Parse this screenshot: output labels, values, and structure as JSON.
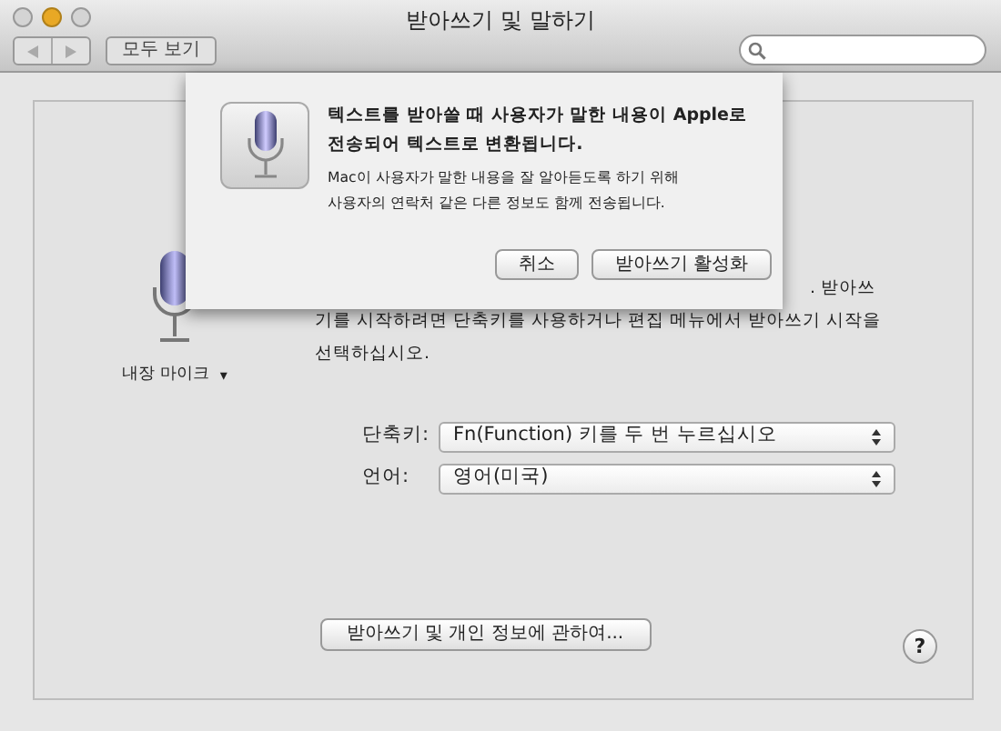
{
  "window": {
    "title": "받아쓰기 및 말하기"
  },
  "toolbar": {
    "show_all_button": "모두 보기"
  },
  "input_device": {
    "label": "내장 마이크",
    "caret": "▾"
  },
  "description": {
    "first_line_visible_end": ". 받아쓰",
    "rest": "기를 시작하려면 단축키를 사용하거나 편집 메뉴에서 받아쓰기 시작을 선택하십시오."
  },
  "settings": [
    {
      "label": "단축키:",
      "value": "Fn(Function) 키를 두 번 누르십시오"
    },
    {
      "label": "언어:",
      "value": "영어(미국)"
    }
  ],
  "privacy_button": "받아쓰기 및 개인 정보에 관하여...",
  "help_button": "?",
  "sheet": {
    "title": "텍스트를 받아쓸 때 사용자가 말한 내용이 Apple로 전송되어 텍스트로 변환됩니다.",
    "message": "Mac이 사용자가 말한 내용을 잘 알아듣도록 하기 위해 사용자의 연락처 같은 다른 정보도 함께 전송됩니다.",
    "buttons": [
      "취소",
      "받아쓰기 활성화"
    ]
  }
}
